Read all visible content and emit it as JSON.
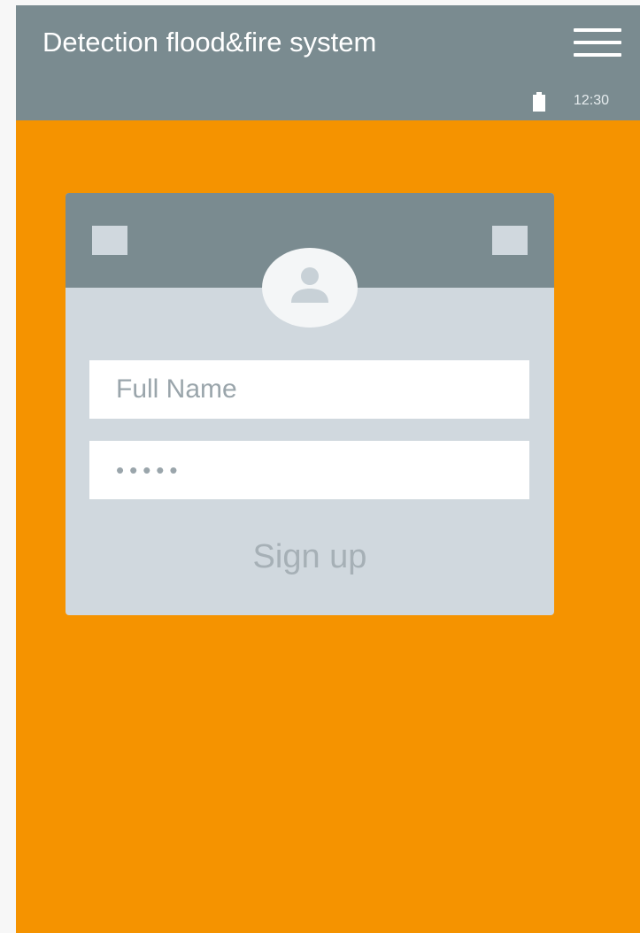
{
  "app_bar": {
    "title": "Detection flood&fire system",
    "menu_icon": "hamburger-menu-icon",
    "battery_icon": "battery-icon",
    "time": "12:30"
  },
  "signup_card": {
    "avatar_icon": "person-icon",
    "name_field": {
      "placeholder": "Full Name",
      "value": ""
    },
    "password_field": {
      "masked_value": "•••••"
    },
    "submit_label": "Sign up"
  },
  "colors": {
    "background": "#f59300",
    "app_bar": "#7a8b90",
    "card": "#d0d8de",
    "field": "#ffffff"
  }
}
